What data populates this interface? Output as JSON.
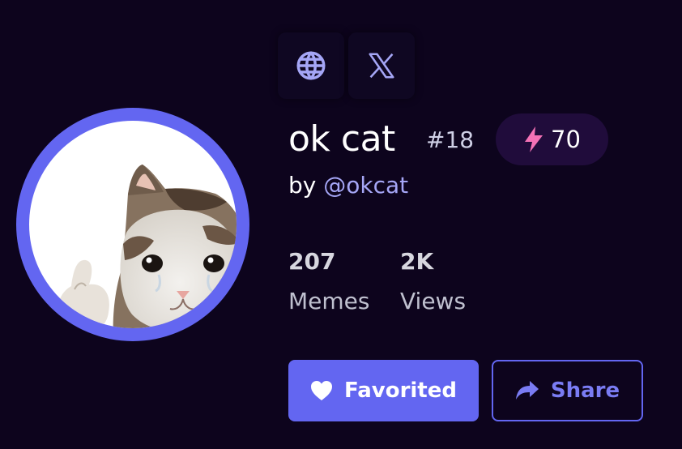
{
  "profile": {
    "name": "ok cat",
    "rank": "#18",
    "score": "70",
    "byline_prefix": "by",
    "handle": "@okcat"
  },
  "stats": [
    {
      "value": "207",
      "label": "Memes"
    },
    {
      "value": "2K",
      "label": "Views"
    }
  ],
  "actions": {
    "favorite_label": "Favorited",
    "share_label": "Share"
  },
  "icons": {
    "website": "globe-icon",
    "twitter": "x-logo-icon",
    "score": "lightning-bolt-icon",
    "favorite": "heart-icon",
    "share": "share-arrow-icon"
  },
  "colors": {
    "background": "#0d041d",
    "accent": "#6366f1",
    "handle": "#a5a6f6",
    "bolt": "#f472b6"
  }
}
